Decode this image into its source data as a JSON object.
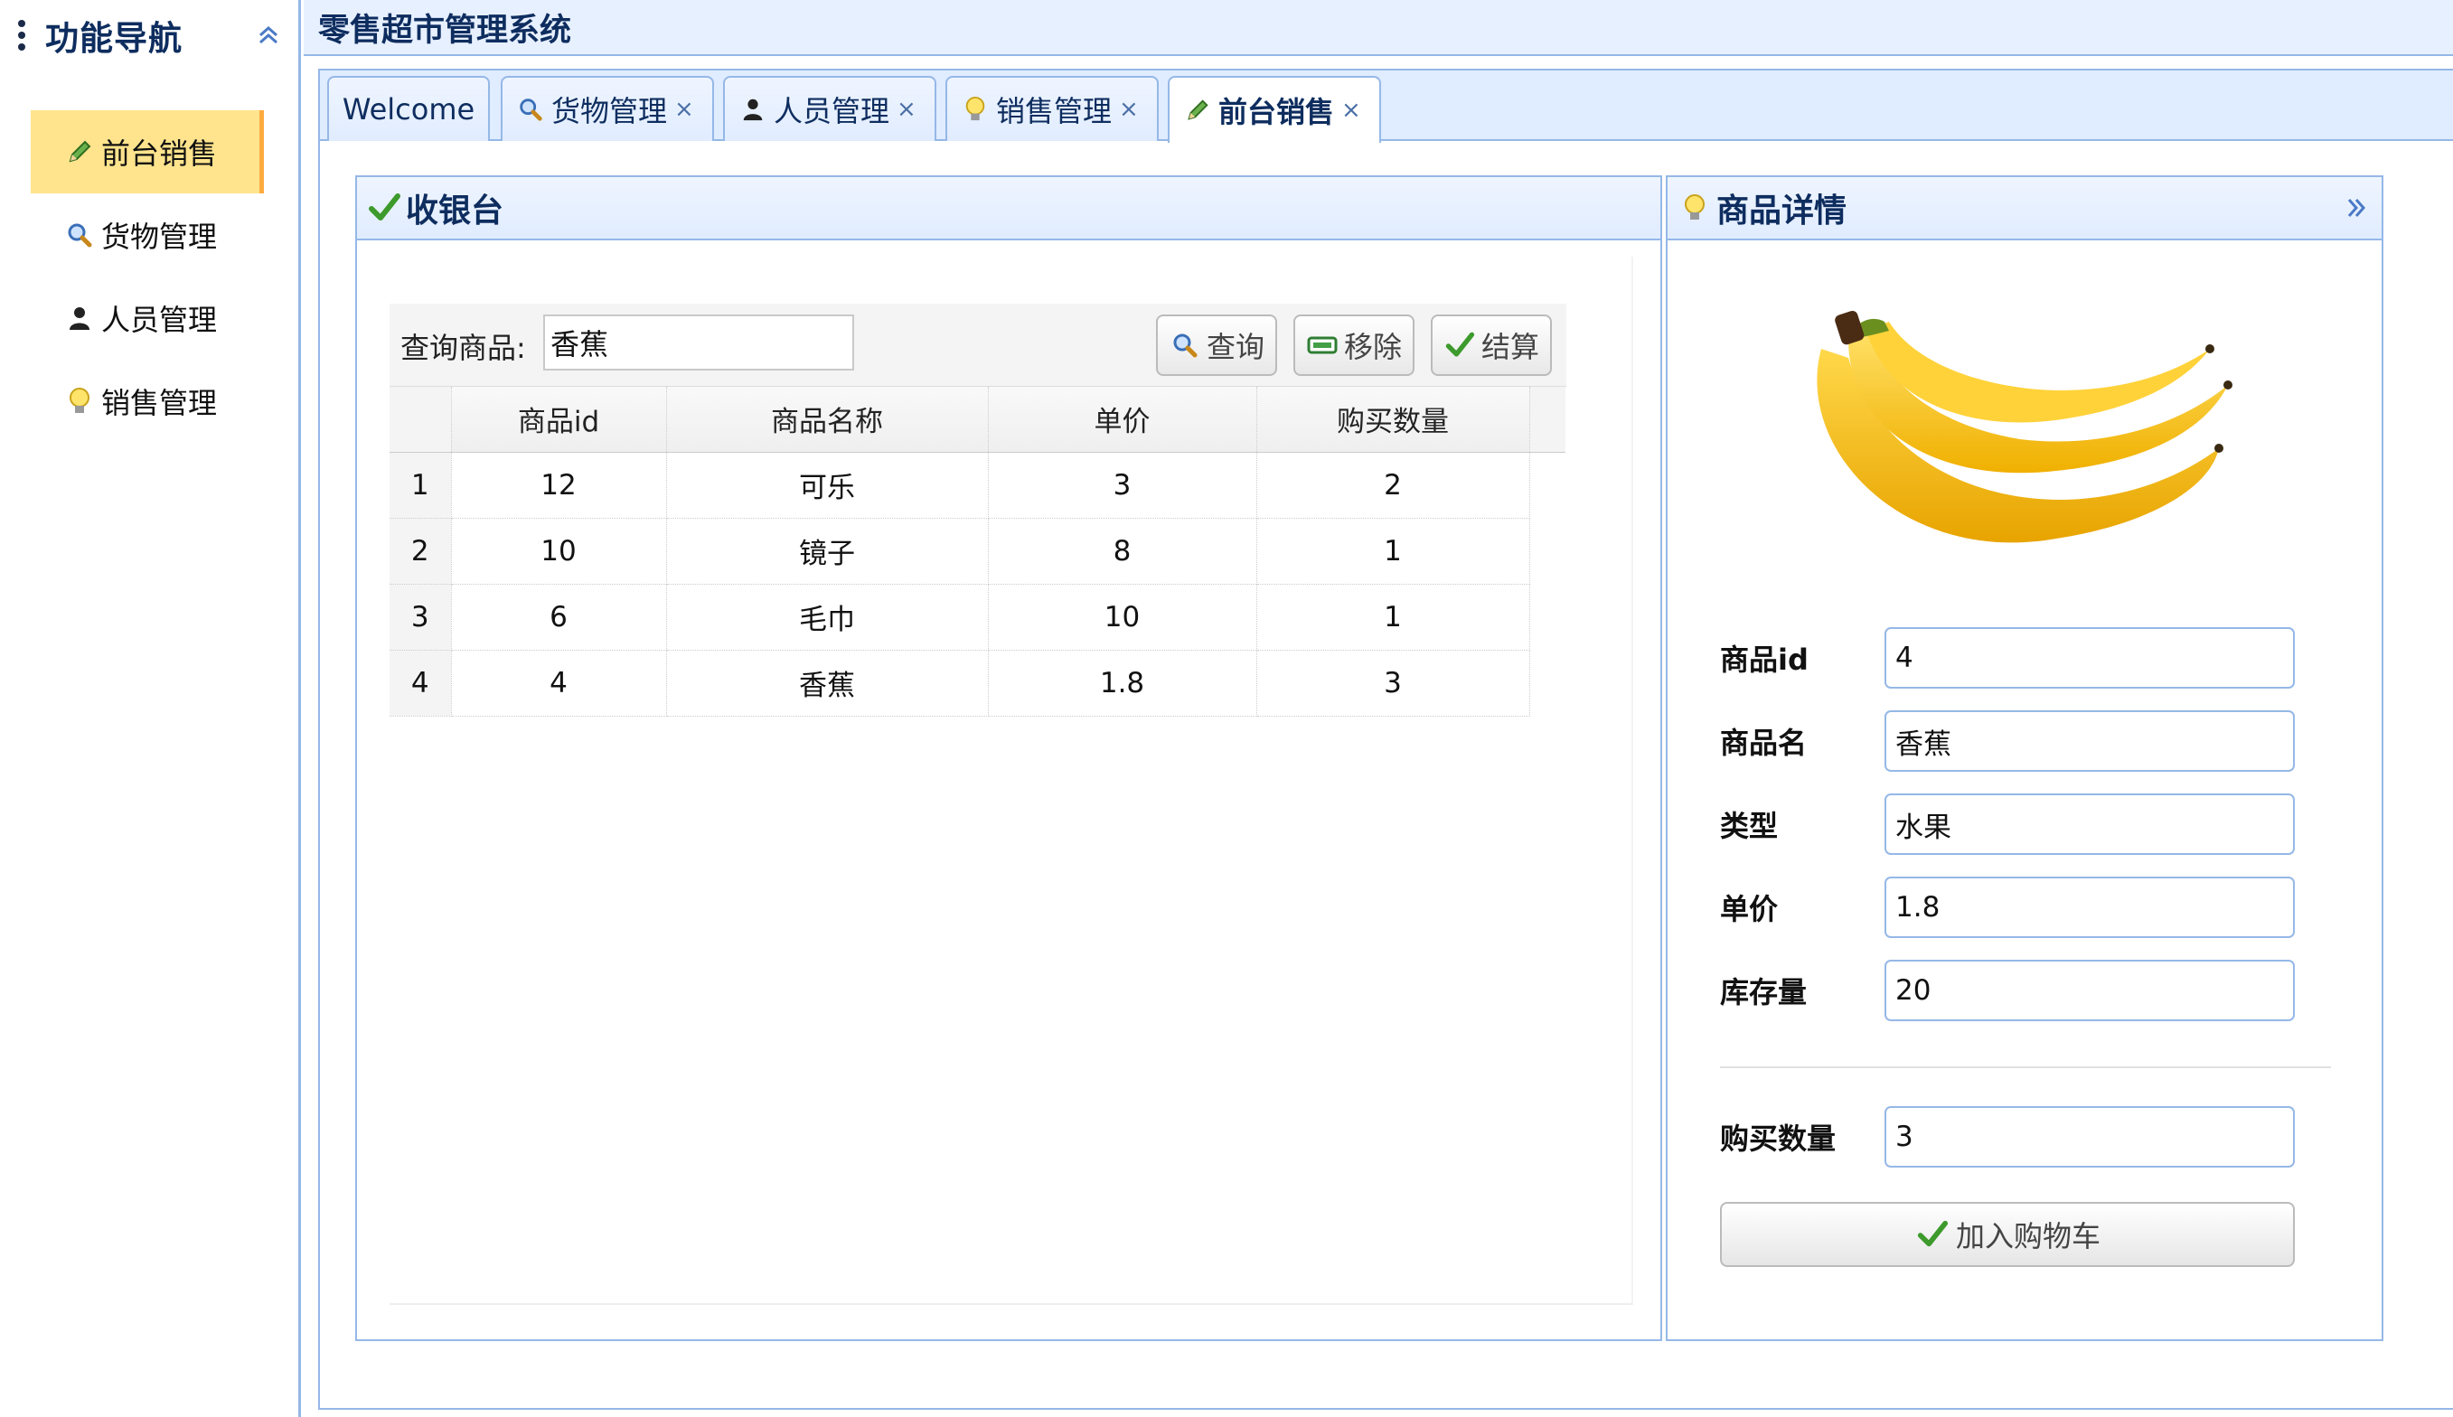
{
  "app": {
    "title": "零售超市管理系统"
  },
  "nav": {
    "title": "功能导航",
    "items": [
      {
        "label": "前台销售",
        "icon": "pencil-icon",
        "active": true
      },
      {
        "label": "货物管理",
        "icon": "search-icon",
        "active": false
      },
      {
        "label": "人员管理",
        "icon": "user-icon",
        "active": false
      },
      {
        "label": "销售管理",
        "icon": "bulb-icon",
        "active": false
      }
    ]
  },
  "tabs": [
    {
      "label": "Welcome",
      "closable": false,
      "active": false
    },
    {
      "label": "货物管理",
      "icon": "search-icon",
      "closable": true,
      "active": false
    },
    {
      "label": "人员管理",
      "icon": "user-icon",
      "closable": true,
      "active": false
    },
    {
      "label": "销售管理",
      "icon": "bulb-icon",
      "closable": true,
      "active": false
    },
    {
      "label": "前台销售",
      "icon": "pencil-icon",
      "closable": true,
      "active": true
    }
  ],
  "tab_close_glyph": "×",
  "cashier": {
    "title": "收银台",
    "search_label": "查询商品:",
    "search_value": "香蕉",
    "buttons": {
      "query": "查询",
      "remove": "移除",
      "checkout": "结算"
    },
    "columns": [
      "商品id",
      "商品名称",
      "单价",
      "购买数量"
    ],
    "rows": [
      {
        "n": "1",
        "id": "12",
        "name": "可乐",
        "price": "3",
        "qty": "2"
      },
      {
        "n": "2",
        "id": "10",
        "name": "镜子",
        "price": "8",
        "qty": "1"
      },
      {
        "n": "3",
        "id": "6",
        "name": "毛巾",
        "price": "10",
        "qty": "1"
      },
      {
        "n": "4",
        "id": "4",
        "name": "香蕉",
        "price": "1.8",
        "qty": "3"
      }
    ]
  },
  "detail": {
    "title": "商品详情",
    "fields": [
      {
        "label": "商品id",
        "value": "4"
      },
      {
        "label": "商品名",
        "value": "香蕉"
      },
      {
        "label": "类型",
        "value": "水果"
      },
      {
        "label": "单价",
        "value": "1.8"
      },
      {
        "label": "库存量",
        "value": "20"
      }
    ],
    "buy_qty_label": "购买数量",
    "buy_qty_value": "3",
    "add_button": "加入购物车"
  },
  "colors": {
    "border": "#95b8e7",
    "header_bg": "#e0ecff",
    "active_nav": "#ffe48d",
    "title_text": "#0e2d5f"
  }
}
